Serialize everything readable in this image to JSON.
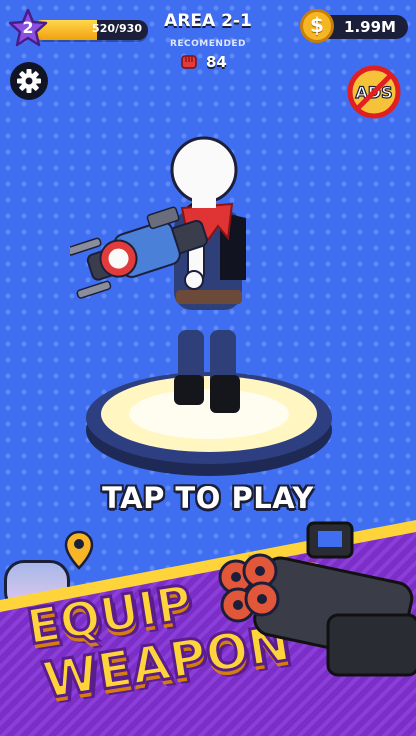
{
  "player": {
    "level": "2",
    "xp_text": "520/930",
    "xp_progress": 0.56
  },
  "area": {
    "title": "AREA 2-1",
    "recommended_label": "RECOMENDED",
    "recommended_power": "84"
  },
  "currency": {
    "coin_symbol": "$",
    "amount": "1.99M"
  },
  "buttons": {
    "no_ads_label": "ADS"
  },
  "main": {
    "tap_to_play": "TAP TO PLAY"
  },
  "promo": {
    "line1": "EQUIP",
    "line2": "WEAPON"
  },
  "colors": {
    "background": "#3f6ef0",
    "promo_purple": "#7b2fc8",
    "promo_yellow": "#ffd43a",
    "hud_dark": "#1b1f3a",
    "coin": "#f6b623"
  },
  "icons": [
    "star-icon",
    "fist-icon",
    "coin-icon",
    "gear-icon",
    "no-ads-icon",
    "map-pin-icon"
  ]
}
